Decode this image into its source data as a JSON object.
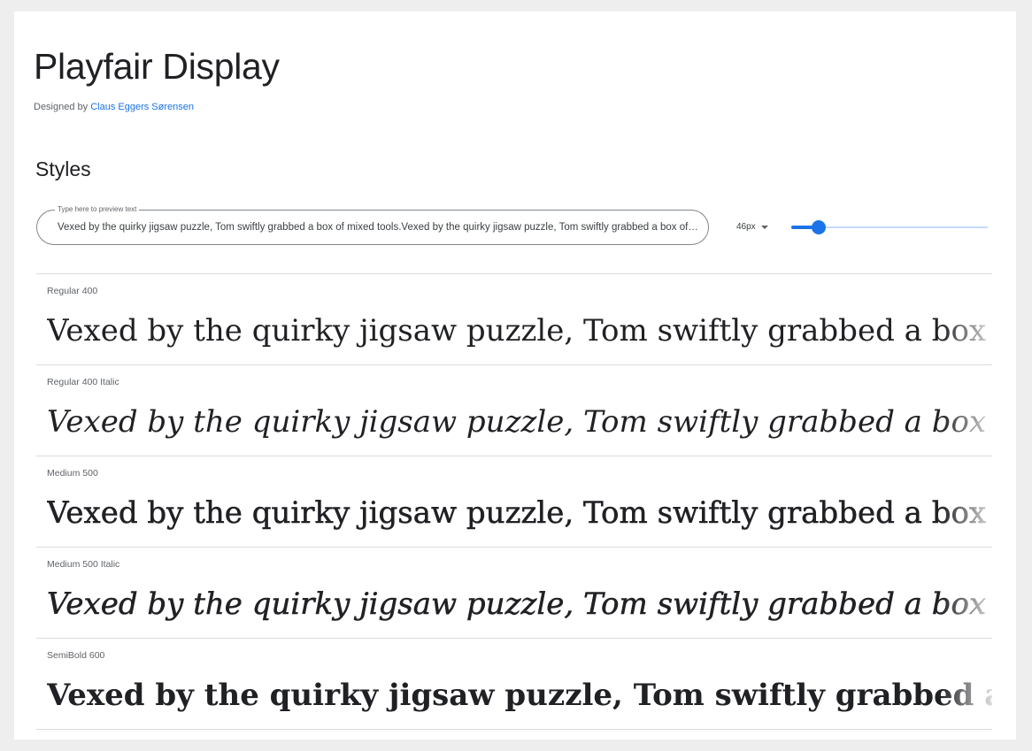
{
  "family": {
    "name": "Playfair Display",
    "designed_by_label": "Designed by",
    "designer": "Claus Eggers Sørensen"
  },
  "styles_section": {
    "title": "Styles"
  },
  "preview": {
    "label": "Type here to preview text",
    "value": "Vexed by the quirky jigsaw puzzle, Tom swiftly grabbed a box of mixed tools.Vexed by the quirky jigsaw puzzle, Tom swiftly grabbed a box of mixed tools."
  },
  "size_control": {
    "selected": "46px",
    "slider_fraction": 0.14
  },
  "sample_text": "Vexed by the quirky jigsaw puzzle, Tom swiftly grabbed a box of mixed tools.",
  "styles": [
    {
      "name": "Regular 400",
      "weight": 400,
      "italic": false
    },
    {
      "name": "Regular 400 Italic",
      "weight": 400,
      "italic": true
    },
    {
      "name": "Medium 500",
      "weight": 500,
      "italic": false
    },
    {
      "name": "Medium 500 Italic",
      "weight": 500,
      "italic": true
    },
    {
      "name": "SemiBold 600",
      "weight": 600,
      "italic": false
    }
  ],
  "colors": {
    "accent": "#1a73e8",
    "text": "#202124",
    "muted": "#5f6368",
    "divider": "#dadce0",
    "page_background": "#eeeeee"
  }
}
